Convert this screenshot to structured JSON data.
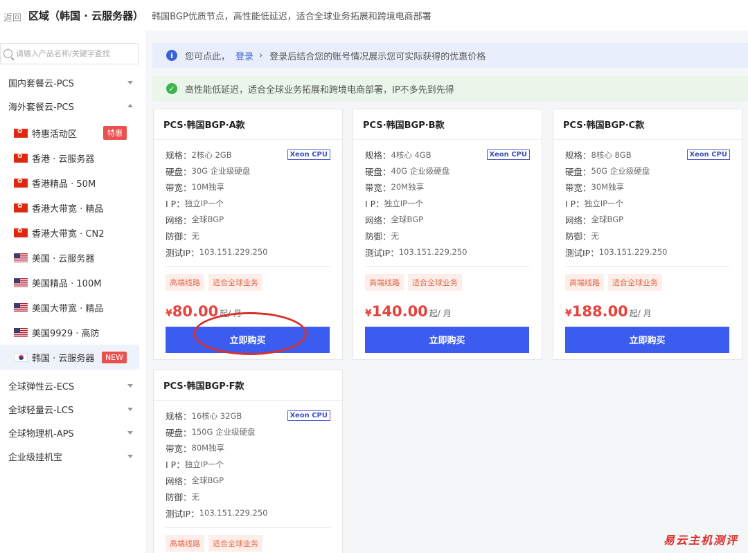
{
  "header": {
    "back": "返回",
    "title": "区域（韩国 · 云服务器）",
    "desc": "韩国BGP优质节点，高性能低延迟，适合全球业务拓展和跨境电商部署"
  },
  "sidebar": {
    "search_placeholder": "请输入产品名称/关键字查找",
    "categories": [
      {
        "label": "国内套餐云-PCS"
      },
      {
        "label": "海外套餐云-PCS"
      },
      {
        "label": "全球弹性云-ECS"
      },
      {
        "label": "全球轻量云-LCS"
      },
      {
        "label": "全球物理机-APS"
      },
      {
        "label": "企业级挂机宝"
      }
    ],
    "items": [
      {
        "label": "特惠活动区",
        "flag": "hk",
        "tag": "特惠"
      },
      {
        "label": "香港 · 云服务器",
        "flag": "hk"
      },
      {
        "label": "香港精品 · 50M",
        "flag": "hk"
      },
      {
        "label": "香港大带宽 · 精品",
        "flag": "hk"
      },
      {
        "label": "香港大带宽 · CN2",
        "flag": "hk"
      },
      {
        "label": "美国 · 云服务器",
        "flag": "us"
      },
      {
        "label": "美国精品 · 100M",
        "flag": "us"
      },
      {
        "label": "美国大带宽 · 精品",
        "flag": "us"
      },
      {
        "label": "美国9929 · 高防",
        "flag": "us"
      },
      {
        "label": "韩国 · 云服务器",
        "flag": "kr",
        "tag": "NEW"
      }
    ]
  },
  "notices": {
    "info_prefix": "您可点此，",
    "info_link": "登录",
    "info_chevron": "›",
    "info_suffix": "登录后结合您的账号情况展示您可实际获得的优惠价格",
    "success": "高性能低延迟，适合全球业务拓展和跨境电商部署，IP不多先到先得"
  },
  "spec_labels": {
    "spec": "规格：",
    "disk": "硬盘：",
    "bandwidth": "带宽：",
    "ip": "I P：",
    "network": "网络：",
    "defense": "防御：",
    "test_ip": "测试IP："
  },
  "cards": [
    {
      "title": "PCS·韩国BGP·A款",
      "cpu": "Xeon CPU",
      "spec": "2核心 2GB",
      "disk": "30G 企业级硬盘",
      "bandwidth": "10M独享",
      "ip": "独立IP一个",
      "network": "全球BGP",
      "defense": "无",
      "test_ip": "103.151.229.250",
      "chip1": "高端线路",
      "chip2": "适合全球业务",
      "yen": "¥",
      "price": "80.00",
      "unit": "起/ 月",
      "buy": "立即购买"
    },
    {
      "title": "PCS·韩国BGP·B款",
      "cpu": "Xeon CPU",
      "spec": "4核心 4GB",
      "disk": "40G 企业级硬盘",
      "bandwidth": "20M独享",
      "ip": "独立IP一个",
      "network": "全球BGP",
      "defense": "无",
      "test_ip": "103.151.229.250",
      "chip1": "高端线路",
      "chip2": "适合全球业务",
      "yen": "¥",
      "price": "140.00",
      "unit": "起/ 月",
      "buy": "立即购买"
    },
    {
      "title": "PCS·韩国BGP·C款",
      "cpu": "Xeon CPU",
      "spec": "8核心 8GB",
      "disk": "50G 企业级硬盘",
      "bandwidth": "30M独享",
      "ip": "独立IP一个",
      "network": "全球BGP",
      "defense": "无",
      "test_ip": "103.151.229.250",
      "chip1": "高端线路",
      "chip2": "适合全球业务",
      "yen": "¥",
      "price": "188.00",
      "unit": "起/ 月",
      "buy": "立即购买"
    },
    {
      "title": "PCS·韩国BGP·F款",
      "cpu": "Xeon CPU",
      "spec": "16核心 32GB",
      "disk": "150G 企业级硬盘",
      "bandwidth": "80M独享",
      "ip": "独立IP一个",
      "network": "全球BGP",
      "defense": "无",
      "test_ip": "103.151.229.250",
      "chip1": "高端线路",
      "chip2": "适合全球业务"
    }
  ],
  "watermark": "易云主机测评",
  "colors": {
    "accent": "#3c5cf0",
    "price": "#e5433d",
    "tag": "#e9504e"
  }
}
